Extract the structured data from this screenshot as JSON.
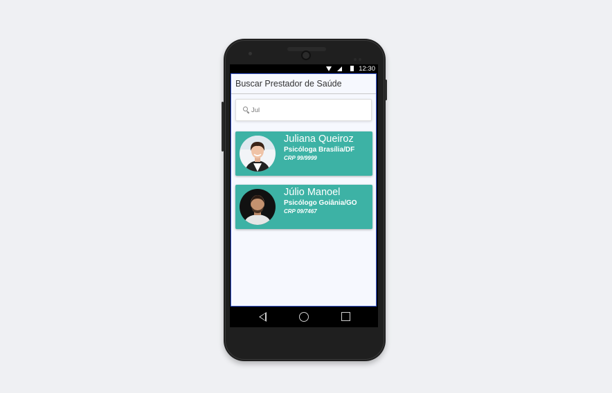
{
  "status_bar": {
    "time": "12:30"
  },
  "app": {
    "title": "Buscar Prestador de Saúde",
    "search": {
      "value": "Jul",
      "placeholder": ""
    }
  },
  "providers": [
    {
      "name": "Juliana Queiroz",
      "role": "Psicóloga Brasília/DF",
      "crp": "CRP 99/9999"
    },
    {
      "name": "Júlio Manoel",
      "role": "Psicólogo Goiânia/GO",
      "crp": "CRP 09/7467"
    }
  ],
  "colors": {
    "card": "#3db2a5",
    "app_background": "#f6f8fe",
    "page_background": "#eff0f3"
  },
  "icons": [
    "wifi-icon",
    "signal-icon",
    "battery-icon",
    "search-icon",
    "back-icon",
    "home-icon",
    "recent-apps-icon"
  ]
}
